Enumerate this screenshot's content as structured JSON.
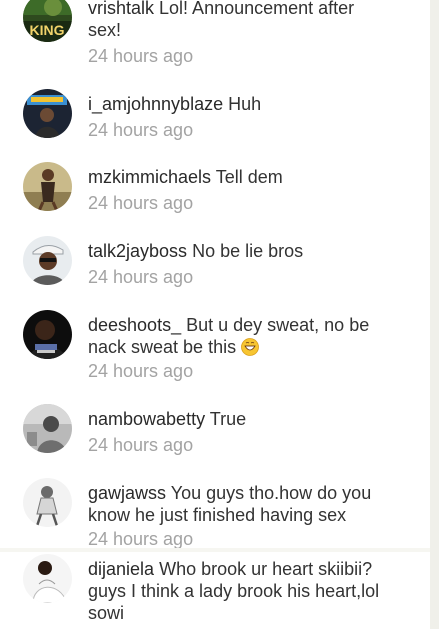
{
  "comments": [
    {
      "username": "vrishtalk",
      "text": "Lol! Announcement after sex!",
      "time": "24 hours ago",
      "avatar_label": "KING"
    },
    {
      "username": "i_amjohnnyblaze",
      "text": "Huh",
      "time": "24 hours ago"
    },
    {
      "username": "mzkimmichaels",
      "text": "Tell dem",
      "time": "24 hours ago"
    },
    {
      "username": "talk2jayboss",
      "text": "No be lie bros",
      "time": "24 hours ago"
    },
    {
      "username": "deeshoots_",
      "text": "But u dey sweat, no be nack sweat be this",
      "time": "24 hours ago",
      "emoji": "grinning-sweat-emoji"
    },
    {
      "username": "nambowabetty",
      "text": "True",
      "time": "24 hours ago"
    },
    {
      "username": "gawjawss",
      "text": "You guys tho.how do you know he just finished having sex",
      "time": "24 hours ago"
    },
    {
      "username": "dijaniela",
      "text": "Who brook ur heart skiibii?guys I think a lady brook his heart,lol sowi",
      "time": ""
    }
  ]
}
